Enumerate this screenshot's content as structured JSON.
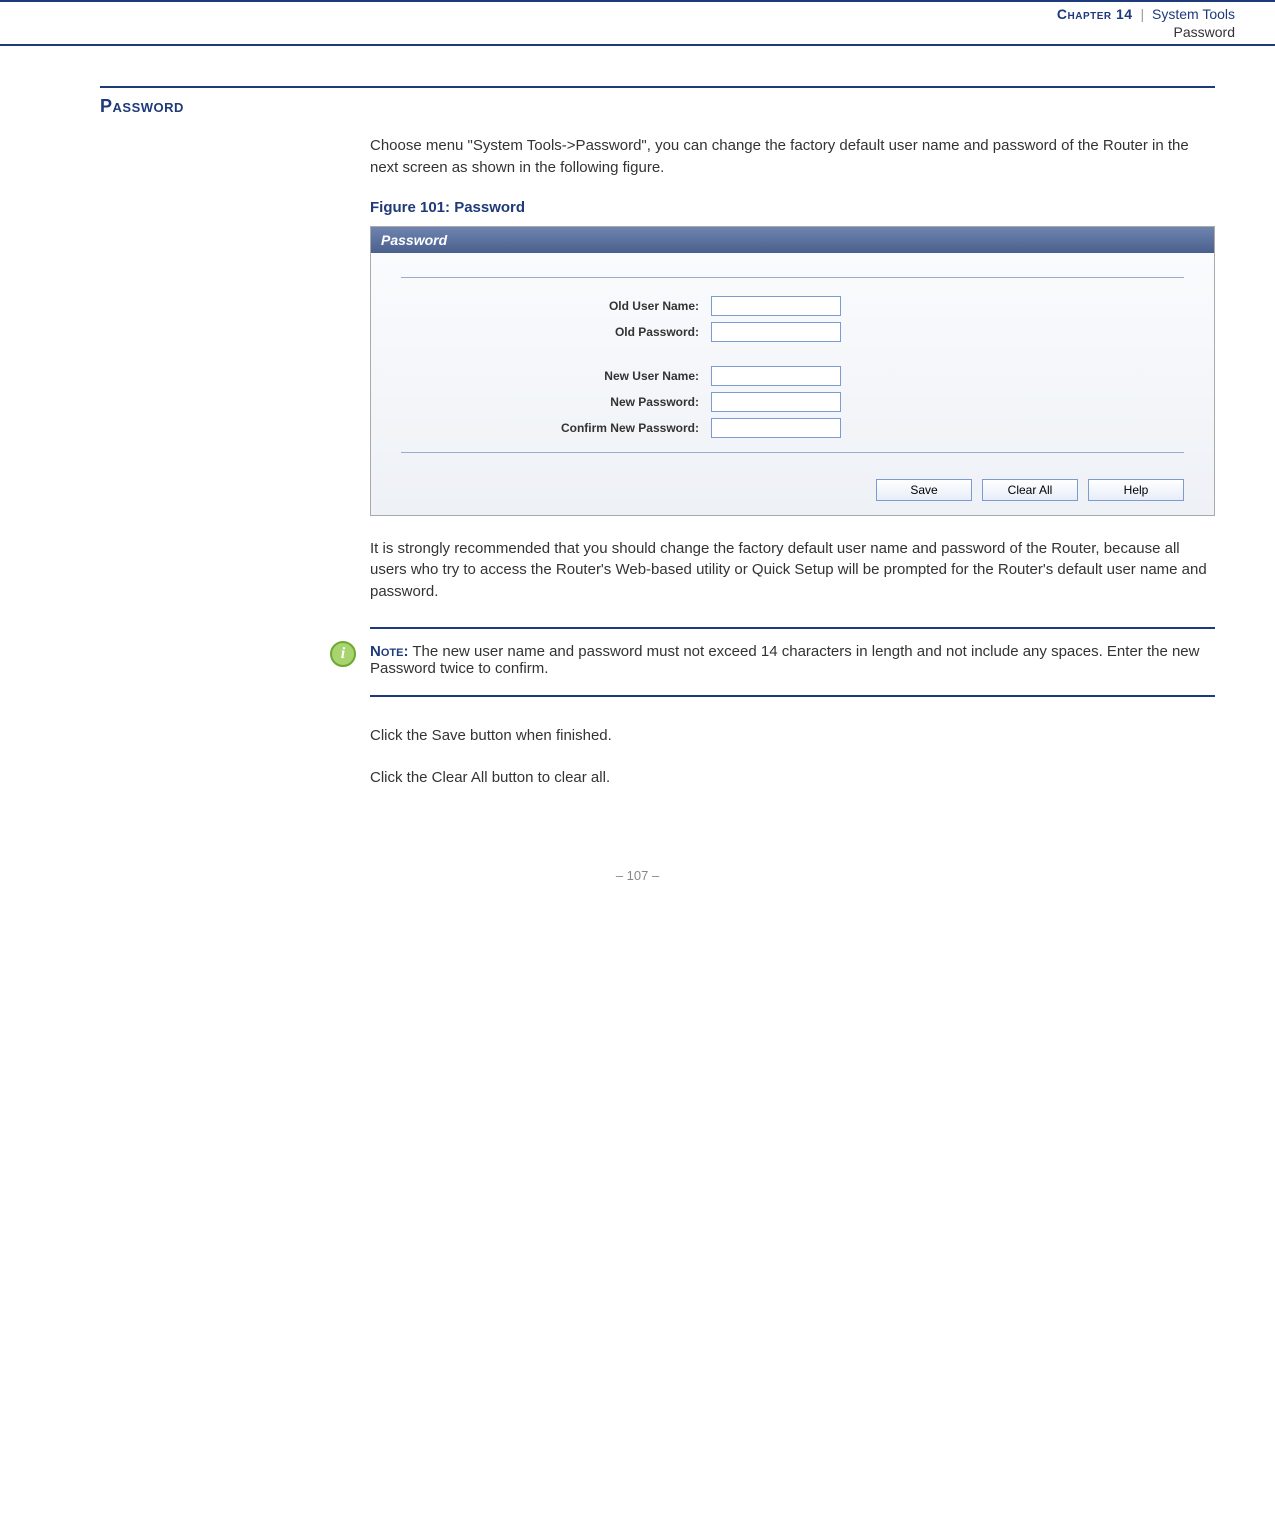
{
  "header": {
    "chapter_label": "Chapter 14",
    "separator": "|",
    "chapter_title": "System Tools",
    "subtitle": "Password"
  },
  "section": {
    "title": "Password",
    "intro": "Choose menu \"System Tools->Password\", you can change the factory default user name and password of the Router in the next screen as shown in the following figure.",
    "figure_caption": "Figure 101:  Password",
    "after_fig": "It is strongly recommended that you should change the factory default user name and password of the Router, because all users who try to access the Router's Web-based utility or Quick Setup will be prompted for the Router's default user name and password.",
    "save_hint": "Click the Save button when finished.",
    "clear_hint": "Click the Clear All button to clear all."
  },
  "router_ui": {
    "panel_title": "Password",
    "fields": {
      "old_user": "Old User Name:",
      "old_pass": "Old Password:",
      "new_user": "New User Name:",
      "new_pass": "New Password:",
      "confirm_pass": "Confirm New Password:"
    },
    "buttons": {
      "save": "Save",
      "clear": "Clear All",
      "help": "Help"
    }
  },
  "note": {
    "icon": "i",
    "label": "Note:",
    "text": " The new user name and password must not exceed 14 characters in length and not include any spaces. Enter the new Password twice to confirm."
  },
  "footer": {
    "page": "–  107  –"
  }
}
